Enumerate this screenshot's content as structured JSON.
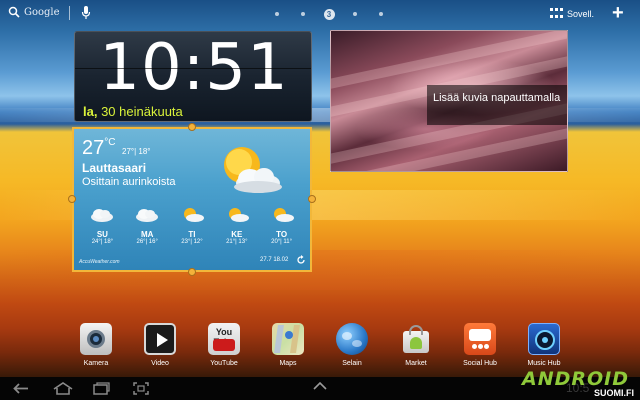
{
  "topbar": {
    "search_brand": "Google",
    "pages": [
      "",
      "",
      "3",
      "",
      ""
    ],
    "active_page": 2,
    "apps_label": "Sovell.",
    "add_label": "+"
  },
  "clock": {
    "time": "10:51",
    "date_day": "la,",
    "date_rest": " 30 heinäkuuta"
  },
  "photo": {
    "caption": "Lisää kuvia napauttamalla"
  },
  "weather": {
    "temp": "27",
    "unit": "°C",
    "range": "27°| 18°",
    "city": "Lauttasaari",
    "condition": "Osittain aurinkoista",
    "days": [
      {
        "name": "SU",
        "temps": "24°| 18°",
        "icon": "cloud-icon"
      },
      {
        "name": "MA",
        "temps": "26°| 16°",
        "icon": "cloud-icon"
      },
      {
        "name": "TI",
        "temps": "23°| 12°",
        "icon": "partly-sunny-icon"
      },
      {
        "name": "KE",
        "temps": "21°| 13°",
        "icon": "partly-sunny-icon"
      },
      {
        "name": "TO",
        "temps": "20°| 11°",
        "icon": "partly-sunny-icon"
      }
    ],
    "brand": "AccuWeather.com",
    "updated": "27.7 18.02"
  },
  "dock": [
    {
      "label": "Kamera",
      "icon": "camera-icon"
    },
    {
      "label": "Video",
      "icon": "video-icon"
    },
    {
      "label": "YouTube",
      "icon": "youtube-icon",
      "icon_text": "You Tube"
    },
    {
      "label": "Maps",
      "icon": "maps-icon"
    },
    {
      "label": "Selain",
      "icon": "browser-icon"
    },
    {
      "label": "Market",
      "icon": "market-icon"
    },
    {
      "label": "Social Hub",
      "icon": "social-hub-icon"
    },
    {
      "label": "Music Hub",
      "icon": "music-hub-icon"
    }
  ],
  "navbar": {
    "clock": "10:5",
    "watermark_main": "ANDROID",
    "watermark_sub": "SUOMI.FI"
  },
  "colors": {
    "clock_date": "#d9f23a",
    "widget_border": "#f2b73a",
    "navbar_bg": "#050505"
  }
}
